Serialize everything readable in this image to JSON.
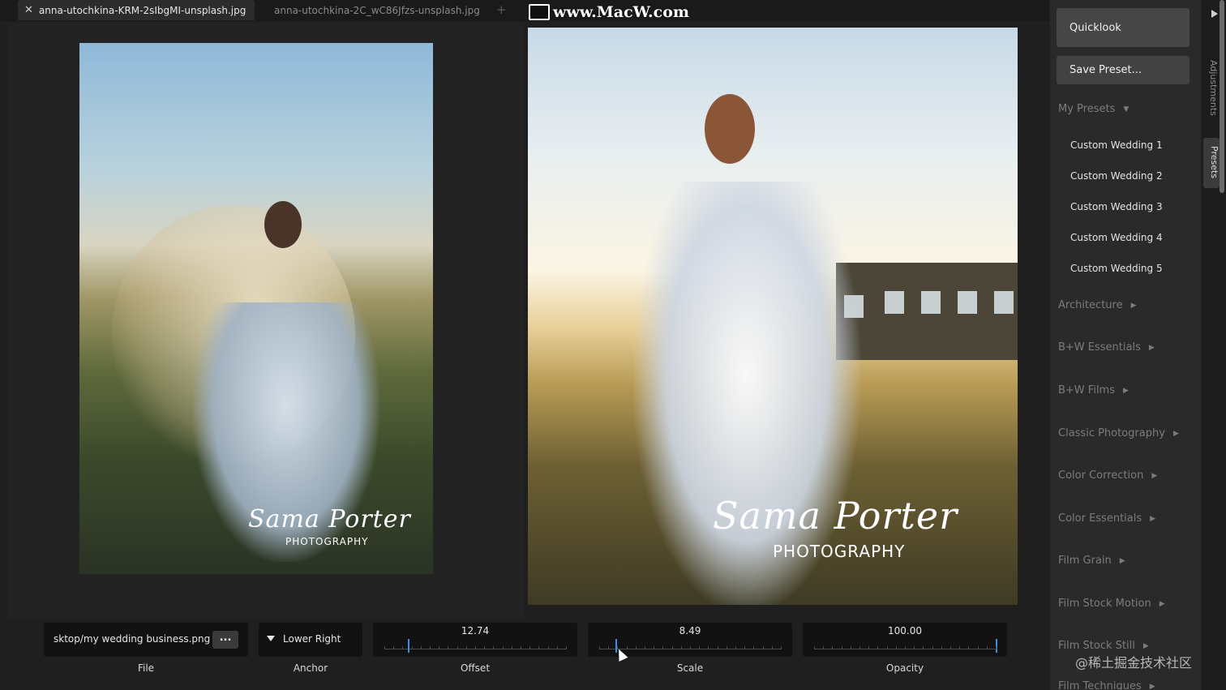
{
  "tabs": [
    {
      "label": "anna-utochkina-KRM-2sIbgMI-unsplash.jpg",
      "active": true
    },
    {
      "label": "anna-utochkina-2C_wC86Jfzs-unsplash.jpg",
      "active": false
    }
  ],
  "tab_add_label": "+",
  "close_glyph": "✕",
  "site_watermark": "www.MacW.com",
  "photo_watermark": {
    "script": "Sama Porter",
    "subtitle": "PHOTOGRAPHY"
  },
  "controls": {
    "file": {
      "value": "sktop/my wedding business.png",
      "button_label": "...",
      "label": "File"
    },
    "anchor": {
      "value": "Lower Right",
      "label": "Anchor"
    },
    "offset": {
      "value": "12.74",
      "label": "Offset",
      "fraction": 0.13
    },
    "scale": {
      "value": "8.49",
      "label": "Scale",
      "fraction": 0.09
    },
    "opacity": {
      "value": "100.00",
      "label": "Opacity",
      "fraction": 1.0
    }
  },
  "panel": {
    "quicklook": "Quicklook",
    "save_preset": "Save Preset...",
    "my_presets": "My Presets",
    "presets": [
      "Custom Wedding 1",
      "Custom Wedding 2",
      "Custom Wedding 3",
      "Custom Wedding 4",
      "Custom Wedding 5"
    ],
    "groups": [
      "Architecture",
      "B+W Essentials",
      "B+W Films",
      "Classic Photography",
      "Color Correction",
      "Color Essentials",
      "Film Grain",
      "Film Stock Motion",
      "Film Stock Still",
      "Film Techniques"
    ]
  },
  "vertical_tabs": {
    "adjustments": "Adjustments",
    "presets": "Presets"
  },
  "corner_watermark": "@稀土掘金技术社区",
  "colors": {
    "accent": "#3d8ce6",
    "panel_bg": "#2a2a2a",
    "control_bg": "#121212"
  }
}
